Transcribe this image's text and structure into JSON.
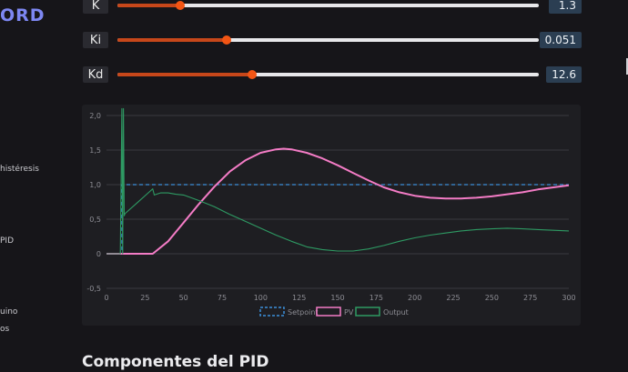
{
  "sidebar": {
    "logo": "ORD",
    "links": [
      "histéresis",
      "PID",
      "uino",
      "os"
    ]
  },
  "sliders": [
    {
      "label": "K",
      "value": "1.3",
      "fraction": 0.15
    },
    {
      "label": "Ki",
      "value": "0.051",
      "fraction": 0.26
    },
    {
      "label": "Kd",
      "value": "12.6",
      "fraction": 0.32
    }
  ],
  "colors": {
    "slider_fill": "#c7471a",
    "slider_thumb": "#f25514",
    "setpoint": "#3b8fd9",
    "pv": "#f47cc6",
    "output": "#2e9a63"
  },
  "chart_data": {
    "type": "line",
    "title": "",
    "xlabel": "",
    "ylabel": "",
    "xlim": [
      0,
      300
    ],
    "ylim": [
      -0.5,
      2.0
    ],
    "x_ticks": [
      "0",
      "25",
      "50",
      "75",
      "100",
      "125",
      "150",
      "175",
      "200",
      "225",
      "250",
      "275",
      "300"
    ],
    "y_ticks": [
      "2,0",
      "1,5",
      "1,0",
      "0,5",
      "0",
      "-0,5"
    ],
    "y_tick_values": [
      2.0,
      1.5,
      1.0,
      0.5,
      0,
      -0.5
    ],
    "grid": true,
    "legend_position": "bottom",
    "series": [
      {
        "name": "Setpoint",
        "style": "dashed",
        "x": [
          0,
          9,
          10,
          10,
          300
        ],
        "y": [
          0,
          0,
          0,
          1.0,
          1.0
        ]
      },
      {
        "name": "PV",
        "style": "solid",
        "x": [
          0,
          30,
          40,
          50,
          60,
          70,
          80,
          90,
          100,
          110,
          115,
          120,
          130,
          140,
          150,
          160,
          170,
          180,
          190,
          200,
          210,
          220,
          230,
          240,
          250,
          260,
          270,
          280,
          290,
          300
        ],
        "y": [
          0,
          0,
          0.18,
          0.45,
          0.72,
          0.97,
          1.19,
          1.35,
          1.46,
          1.51,
          1.52,
          1.51,
          1.46,
          1.38,
          1.28,
          1.17,
          1.06,
          0.96,
          0.89,
          0.84,
          0.81,
          0.8,
          0.8,
          0.81,
          0.83,
          0.86,
          0.89,
          0.93,
          0.96,
          0.99
        ]
      },
      {
        "name": "Output",
        "style": "solid",
        "x": [
          0,
          8,
          9,
          10,
          10.5,
          11,
          11.5,
          12,
          20,
          30,
          31,
          35,
          40,
          45,
          50,
          60,
          70,
          80,
          90,
          100,
          110,
          120,
          130,
          140,
          150,
          160,
          170,
          180,
          190,
          200,
          210,
          220,
          230,
          240,
          250,
          260,
          270,
          280,
          290,
          300
        ],
        "y": [
          0,
          0,
          0,
          2.1,
          0,
          2.1,
          0.55,
          0.58,
          0.74,
          0.94,
          0.85,
          0.88,
          0.88,
          0.86,
          0.85,
          0.77,
          0.68,
          0.57,
          0.47,
          0.37,
          0.27,
          0.18,
          0.1,
          0.06,
          0.04,
          0.04,
          0.07,
          0.12,
          0.18,
          0.23,
          0.27,
          0.3,
          0.33,
          0.35,
          0.36,
          0.37,
          0.36,
          0.35,
          0.34,
          0.33
        ]
      }
    ]
  },
  "content": {
    "section_title": "Componentes del PID"
  }
}
